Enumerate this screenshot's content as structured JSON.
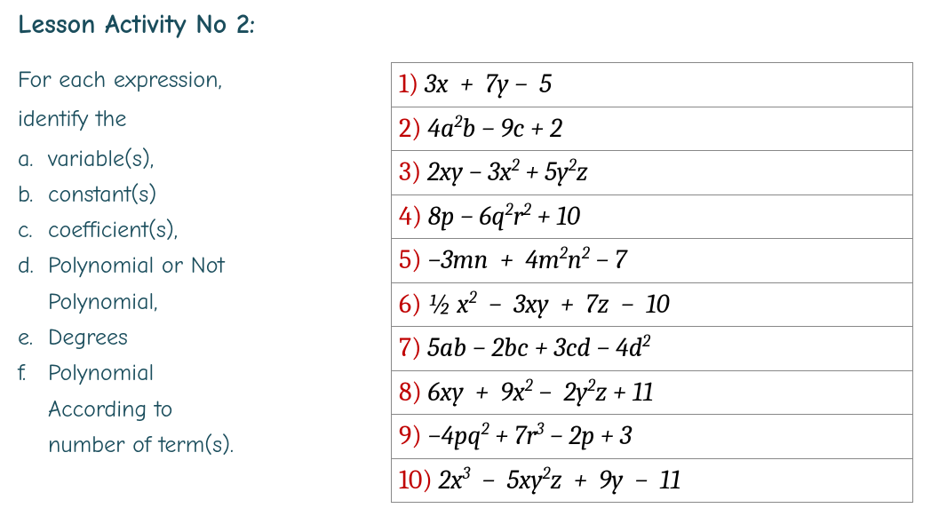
{
  "title": "Lesson Activity No 2:",
  "instructions": {
    "lead1": "For each expression,",
    "lead2": "identify the",
    "items": [
      {
        "letter": "a.",
        "text": "variable(s),"
      },
      {
        "letter": "b.",
        "text": "constant(s)"
      },
      {
        "letter": "c.",
        "text": "coefficient(s),"
      },
      {
        "letter": "d.",
        "text": "Polynomial or Not"
      },
      {
        "letter": "",
        "text": "Polynomial,"
      },
      {
        "letter": "e.",
        "text": "Degrees"
      },
      {
        "letter": "f.",
        "text": "Polynomial"
      },
      {
        "letter": "",
        "text": "According to"
      },
      {
        "letter": "",
        "text": "number of term(s)."
      }
    ]
  },
  "expressions": [
    {
      "n": "1)",
      "expr_html": "3<i>x</i> &nbsp;+&nbsp; 7<i>y</i> − &nbsp;5"
    },
    {
      "n": "2)",
      "expr_html": "4<i>a</i><sup>2</sup><i>b</i> − 9<i>c</i> + 2"
    },
    {
      "n": "3)",
      "expr_html": "2<i>xy</i> − 3<i>x</i><sup>2</sup> + 5<i>y</i><sup>2</sup><i>z</i>"
    },
    {
      "n": "4)",
      "expr_html": "8<i>p</i> − 6<i>q</i><sup>2</sup><i>r</i><sup>2</sup> + 10"
    },
    {
      "n": "5)",
      "expr_html": "−3<i>mn</i> &nbsp;+&nbsp; 4<i>m</i><sup>2</sup><i>n</i><sup>2</sup> − 7"
    },
    {
      "n": "6)",
      "expr_html": "½ <i>x</i><sup>2</sup> &nbsp;−&nbsp; 3<i>xy</i> &nbsp;+&nbsp; 7<i>z</i> &nbsp;−&nbsp; 10"
    },
    {
      "n": "7)",
      "expr_html": "5<i>ab</i> − 2<i>bc</i> + 3<i>cd</i> − 4<i>d</i><sup>2</sup>"
    },
    {
      "n": "8)",
      "expr_html": "6<i>xy</i> &nbsp;+&nbsp; 9<i>x</i><sup>2</sup> −&nbsp; 2<i>y</i><sup>2</sup><i>z</i> + 11"
    },
    {
      "n": "9)",
      "expr_html": "−4<i>pq</i><sup>2</sup> + 7<i>r</i><sup>3</sup> − 2<i>p</i> + 3"
    },
    {
      "n": "10)",
      "expr_html": "2<i>x</i><sup>3</sup> &nbsp;−&nbsp; 5<i>xy</i><sup>2</sup><i>z</i> &nbsp;+&nbsp; 9<i>y</i> &nbsp;−&nbsp; 11"
    }
  ]
}
